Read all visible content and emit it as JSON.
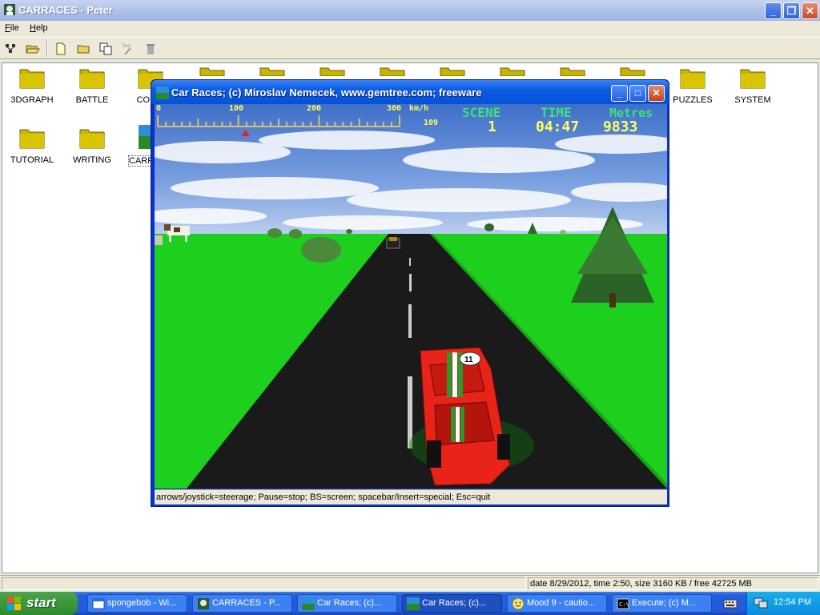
{
  "main_window": {
    "title": "CARRACES - Peter",
    "menu": [
      {
        "label_u": "F",
        "label_rest": "ile"
      },
      {
        "label_u": "H",
        "label_rest": "elp"
      }
    ],
    "toolbar_icons": [
      "tree-icon",
      "open-folder-icon",
      "new-file-icon",
      "new-folder-icon",
      "copy-icon",
      "rename-text-icon",
      "trash-icon"
    ],
    "rename_text_label": "Text",
    "folders": [
      {
        "label": "3DGRAPH"
      },
      {
        "label": "BATTLE"
      },
      {
        "label": "COMM"
      },
      {
        "label": "PUZZLES"
      },
      {
        "label": "SYSTEM"
      },
      {
        "label": "TUTORIAL"
      },
      {
        "label": "WRITING"
      },
      {
        "label": "CARR"
      }
    ],
    "status": "date 8/29/2012, time 2:50, size 3160 KB / free 42725 MB"
  },
  "game_window": {
    "title": "Car Races;   (c) Miroslav Nemecek, www.gemtree.com;   freeware",
    "speed_ticks": [
      "0",
      "100",
      "200",
      "300"
    ],
    "speed_unit": "km/h",
    "speed_value": "109",
    "speed_fraction": 0.363,
    "scene_label": "SCENE",
    "scene_value": "1",
    "time_label": "TIME",
    "time_value": "04:47",
    "metres_label": "Metres",
    "metres_value": "9833",
    "help_text": "arrows/joystick=steerage;  Pause=stop;  BS=screen;  spacebar/Insert=special;  Esc=quit",
    "car_number": "11"
  },
  "taskbar": {
    "start_label": "start",
    "items": [
      {
        "label": "spongebob - Wi...",
        "icon": "window-icon"
      },
      {
        "label": "CARRACES - P...",
        "icon": "peter-icon"
      },
      {
        "label": "Car Races;   (c)...",
        "icon": "carraces-icon"
      },
      {
        "label": "Car Races;   (c)...",
        "icon": "carraces-icon"
      },
      {
        "label": "Mood 9 - cautio...",
        "icon": "smiley-icon"
      },
      {
        "label": "Execute;   (c) M...",
        "icon": "console-icon"
      }
    ],
    "clock": "12:54 PM"
  },
  "colors": {
    "sky": "#4d7fd3",
    "grass": "#1ed01e",
    "road": "#1a1a1a",
    "hud_green": "#3fe07a",
    "hud_yellow": "#ffff60",
    "car_red": "#e82418"
  }
}
